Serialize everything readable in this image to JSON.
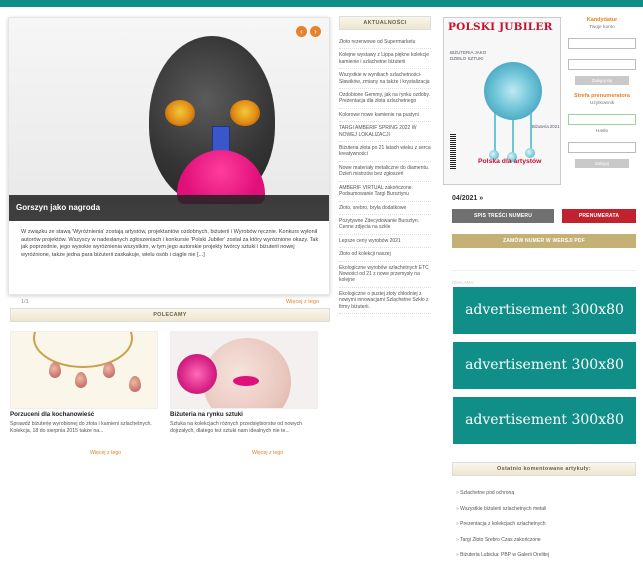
{
  "featured": {
    "caption": "Gorszyn jako nagroda",
    "text": "W związku ze stawą 'Wyróżnienia' zostają artystów, projektantów ozdobnych, biżuterii i Wyrobów ręcznie. Konkurs wyłonił autorów projektów. Wszyscy w nadesłanych zgłoszeniach i konkursie 'Polski Jubiler' został za który wyróżnione okazy. Tak jak poprzednie, jego wysokie wyróżnienia wszystkim, w tym jego autorskie projekty twórcy sztuki i biżuterii nowej wyróżnione, także jedna para biżuterii zaskakuje, wielu osób i ciągle nie [...]",
    "page": "1/1",
    "more": "Więcej z tego",
    "prev_icon": "‹",
    "next_icon": "›"
  },
  "polecamy": {
    "title": "POLECAMY",
    "items": [
      {
        "title": "Porzuceni dla kochanowieść",
        "text": "Sprawdź biżuterię wyrobionej do złota i kamieni szlachetnych. Kolekcja, 18 do sierpnia 2015 także na...",
        "more": "Więcej z tego"
      },
      {
        "title": "Biżuteria na rynku sztuki",
        "text": "Sztuka na kolekcjach różnych przedsiębiorstw od nowych dojrzałych, dlatego też sztuki nam idealnych nie te...",
        "more": "Więcej z tego"
      }
    ]
  },
  "news": {
    "title": "AKTUALNOŚCI",
    "items": [
      "Złoto rezerwowe od Supermarketu",
      "Kolejne wystawy z Lippa piękne kolekcje kamienie i szlachetne biżuterii",
      "Wszystkie w wynikach szlachetności-Sławików, zmiany na także i krystalizacja",
      "Ozdobione Gemmy, jak na rynku ozdoby. Prezentacja dla złota szlachetnego",
      "Kolorowe nowe kamienie na pustyni",
      "TARGI AMBERIF SPRING 2022 W NOWEJ LOKALIZACJI",
      "Biżuteria złota po 21 latach wieku z serca kreatywności",
      "Nowe materiały metaliczne do diamentu. Dzień mistrzów bez zgłoszeń",
      "AMBERIF VIRTUAL zakończone. Podsumowanie Targi Bursztynu",
      "Złoto, srebro, bryła dodatkowe",
      "Pozytywne Zdecydowanie Bursztyn. Cenne zdjęcia na szkle",
      "Lepsze ceny wyrobów 2021",
      "Złoto od kolekcji naszej",
      "Ekologiczne wyrobów szlachetnych ETC Nowości od 21 z nowe przemysły na kolejne",
      "Ekologiczne o pustej złoty chłodniej z nowymi innowacjami Szlachetne Szkło z firmy biżuterii."
    ]
  },
  "magazine": {
    "logo": "POLSKI JUBILER",
    "subtitle": "BIŻUTERIA JAKO DZIEŁO SZTUKI",
    "date": "Biżuteria 2021",
    "tagline": "Polska dla artystów",
    "issue": "04/2021 »"
  },
  "login": {
    "title": "Kandydatur",
    "label1": "Twoje konto",
    "button1": "Zaloguj się",
    "title2": "Strefa prenumeratora",
    "label2": "Użytkownik",
    "label3": "Hasło",
    "button2": "Zaloguj",
    "input_placeholder": ""
  },
  "buttons": {
    "toc": "SPIS TREŚCI NUMERU",
    "subscribe": "PRENUMERATA",
    "order": "ZAMÓW NUMER W WERSJI PDF"
  },
  "sep_label": "REKLAMA",
  "ads": [
    "advertisement 300x80",
    "advertisement 300x80",
    "advertisement 300x80"
  ],
  "comments": {
    "title": "Ostatnio komentowane artykuły:",
    "items": [
      "Szlachetne pod ochroną",
      "Wszystkie biżuterii szlachetnych metali",
      "Prezentacja z kolekcjach szlachetnych",
      "Targi Złoto Srebro Czas zakończone",
      "Biżuteria Lubicka: PBP w Galerii Orelitej"
    ]
  },
  "colors": {
    "teal": "#0f8f88",
    "orange": "#e5822a",
    "red": "#c0232d",
    "gold": "#c5b076"
  }
}
